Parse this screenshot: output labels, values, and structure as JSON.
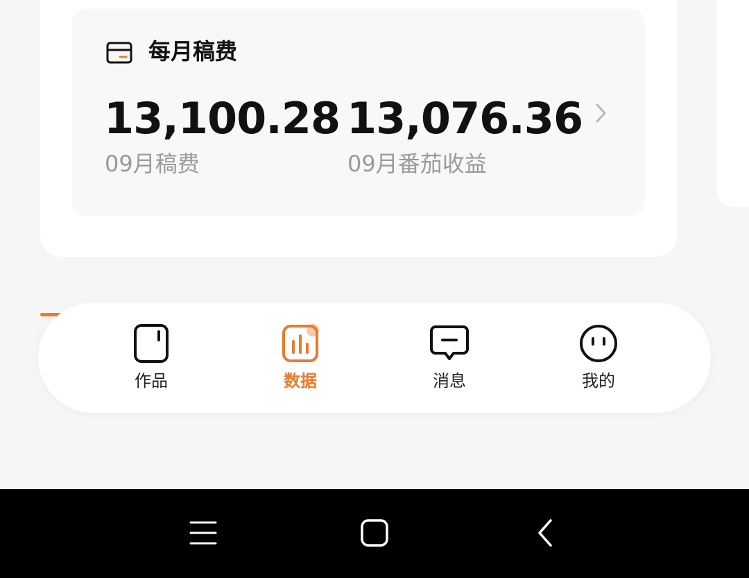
{
  "card": {
    "title": "每月稿费",
    "icon": "wallet-card-icon",
    "stats": [
      {
        "value": "13,100.28",
        "label": "09月稿费"
      },
      {
        "value": "13,076.36",
        "label": "09月番茄收益"
      }
    ]
  },
  "tabbar": {
    "tabs": [
      {
        "label": "作品",
        "icon": "works-icon",
        "active": false
      },
      {
        "label": "数据",
        "icon": "chart-icon",
        "active": true
      },
      {
        "label": "消息",
        "icon": "message-icon",
        "active": false
      },
      {
        "label": "我的",
        "icon": "profile-face-icon",
        "active": false
      }
    ]
  },
  "colors": {
    "accent": "#ec7a2c",
    "background": "#f6f6f6",
    "card": "#ffffff"
  },
  "system_nav": {
    "icons": [
      "menu-icon",
      "home-icon",
      "back-icon"
    ]
  }
}
